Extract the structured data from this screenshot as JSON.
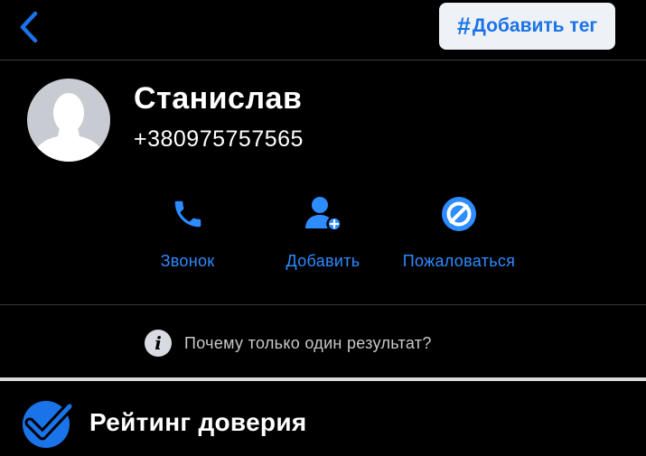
{
  "header": {
    "back_icon": "chevron-left-icon",
    "tag_button": {
      "hash": "#",
      "label": "Добавить тег"
    }
  },
  "contact": {
    "avatar_icon": "person-silhouette-icon",
    "name": "Станислав",
    "phone": "+380975757565"
  },
  "actions": [
    {
      "icon": "phone-icon",
      "label": "Звонок"
    },
    {
      "icon": "add-person-icon",
      "label": "Добавить"
    },
    {
      "icon": "block-icon",
      "label": "Пожаловаться"
    }
  ],
  "info": {
    "icon": "info-icon",
    "glyph": "i",
    "text": "Почему только один результат?"
  },
  "rating": {
    "icon": "shield-check-icon",
    "title": "Рейтинг доверия"
  },
  "colors": {
    "background": "#000000",
    "accent": "#1a73e8",
    "link": "#2d8cff",
    "divider": "#3a3a3c",
    "tag_button_bg": "#eef1f6",
    "avatar_bg": "#c9cbd3"
  }
}
